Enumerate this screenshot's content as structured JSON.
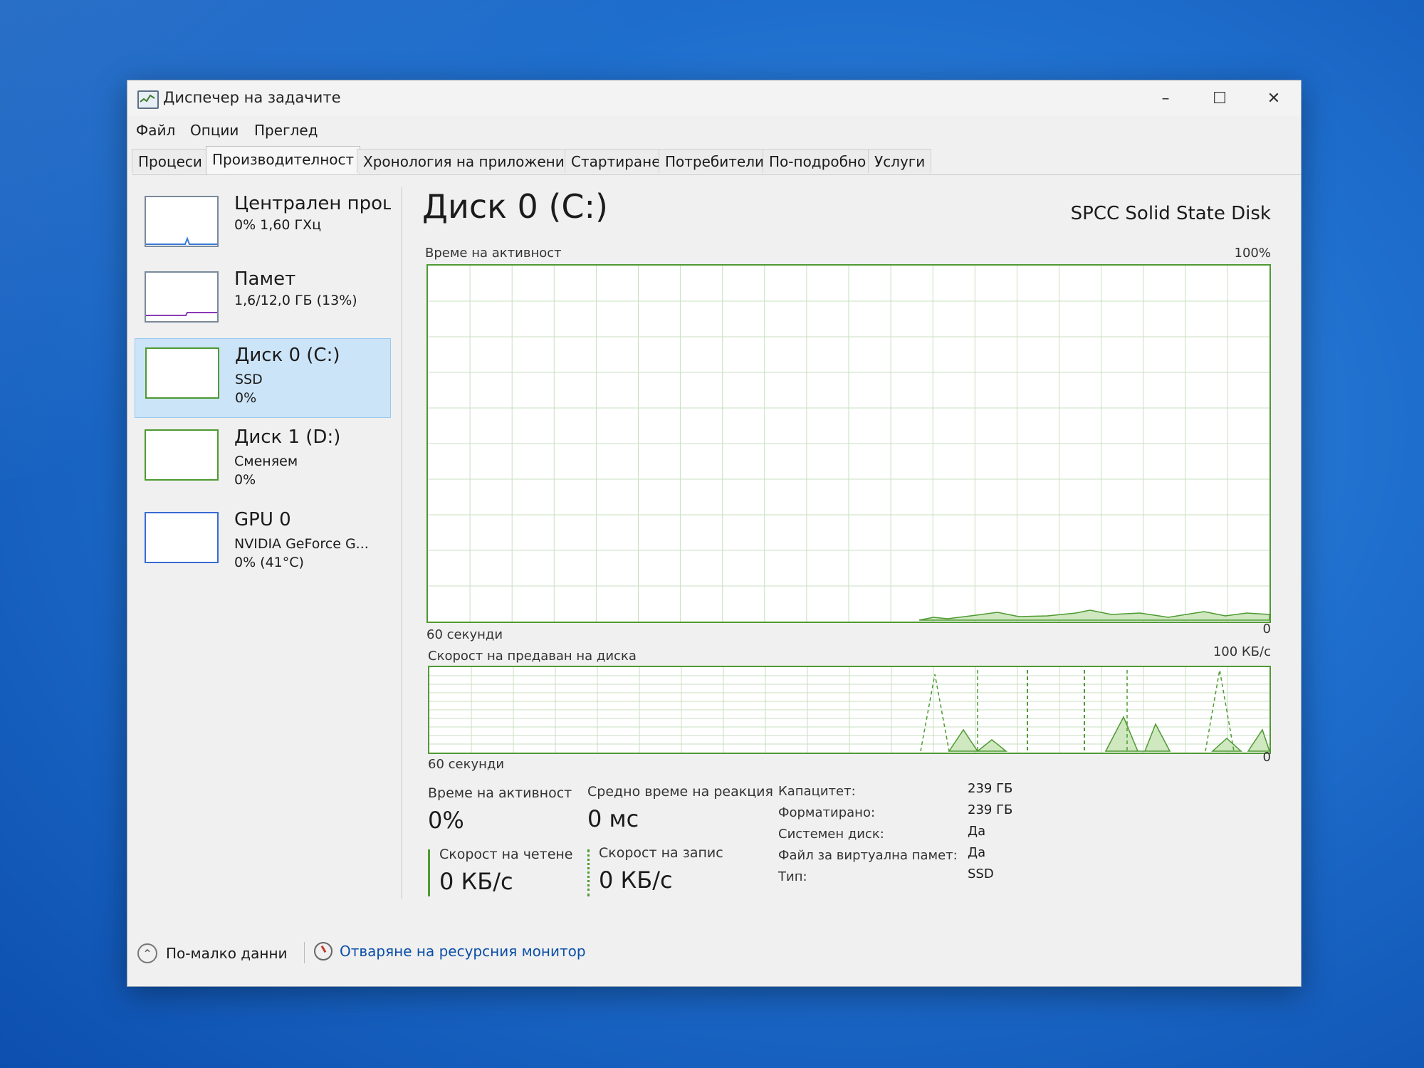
{
  "window": {
    "title": "Диспечер на задачите",
    "controls": {
      "minimize": "–",
      "maximize": "☐",
      "close": "✕"
    }
  },
  "menu": [
    "Файл",
    "Опции",
    "Преглед"
  ],
  "tabs": [
    {
      "label": "Процеси",
      "active": false
    },
    {
      "label": "Производителност",
      "active": true
    },
    {
      "label": "Хронология на приложение",
      "active": false
    },
    {
      "label": "Стартиране",
      "active": false
    },
    {
      "label": "Потребители",
      "active": false
    },
    {
      "label": "По-подробно",
      "active": false
    },
    {
      "label": "Услуги",
      "active": false
    }
  ],
  "sidebar": {
    "items": [
      {
        "name": "Централен проце",
        "line1": "0% 1,60 ГХц",
        "line2": "",
        "selected": false
      },
      {
        "name": "Памет",
        "line1": "1,6/12,0 ГБ (13%)",
        "line2": "",
        "selected": false
      },
      {
        "name": "Диск 0 (C:)",
        "line1": "SSD",
        "line2": "0%",
        "selected": true
      },
      {
        "name": "Диск 1 (D:)",
        "line1": "Сменяем",
        "line2": "0%",
        "selected": false
      },
      {
        "name": "GPU 0",
        "line1": "NVIDIA GeForce G...",
        "line2": "0% (41°C)",
        "selected": false
      }
    ]
  },
  "main": {
    "title": "Диск 0 (C:)",
    "model": "SPCC Solid State Disk",
    "activity_graph": {
      "label": "Време на активност",
      "max_label": "100%",
      "time_label": "60 секунди",
      "min_label": "0"
    },
    "transfer_graph": {
      "label": "Скорост на предаван на диска",
      "max_label": "100 КБ/с",
      "time_label": "60 секунди",
      "min_label": "0"
    },
    "stats": {
      "active_time": {
        "label": "Време на активност",
        "value": "0%"
      },
      "avg_response": {
        "label": "Средно време на реакция",
        "value": "0 мс"
      },
      "read_speed": {
        "label": "Скорост на четене",
        "value": "0 КБ/с"
      },
      "write_speed": {
        "label": "Скорост на запис",
        "value": "0 КБ/с"
      }
    },
    "info": [
      {
        "key": "Капацитет:",
        "value": "239 ГБ"
      },
      {
        "key": "Форматирано:",
        "value": "239 ГБ"
      },
      {
        "key": "Системен диск:",
        "value": "Да"
      },
      {
        "key": "Файл за виртуална памет:",
        "value": "Да"
      },
      {
        "key": "Тип:",
        "value": "SSD"
      }
    ]
  },
  "footer": {
    "fewer_details": "По-малко данни",
    "resource_monitor": "Отваряне на ресурсния монитор"
  },
  "colors": {
    "graph_border": "#4e9a32",
    "graph_fill": "#cfe8c0",
    "selected_bg": "#cce4f7",
    "link": "#0a4fa8"
  }
}
